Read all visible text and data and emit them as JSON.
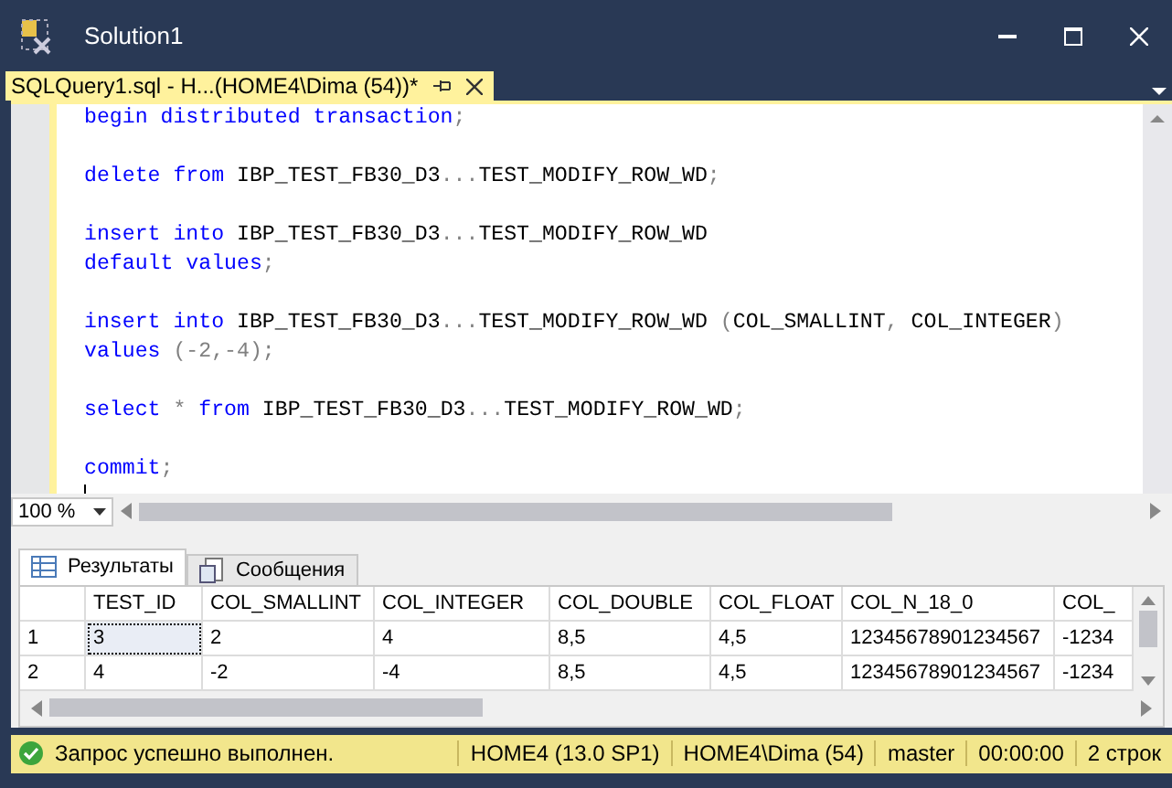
{
  "window": {
    "title": "Solution1"
  },
  "document_tab": {
    "label": "SQLQuery1.sql - H...(HOME4\\Dima (54))*",
    "selected": true
  },
  "editor": {
    "statements": [
      [
        [
          {
            "kind": "keyword",
            "text": "begin distributed transaction"
          },
          {
            "kind": "punct",
            "text": ";"
          }
        ]
      ],
      [
        [
          {
            "kind": "keyword",
            "text": "delete from"
          },
          {
            "kind": "ident",
            "text": " IBP_TEST_FB30_D3"
          },
          {
            "kind": "punct",
            "text": "..."
          },
          {
            "kind": "ident",
            "text": "TEST_MODIFY_ROW_WD"
          },
          {
            "kind": "punct",
            "text": ";"
          }
        ]
      ],
      [
        [
          {
            "kind": "keyword",
            "text": "insert into"
          },
          {
            "kind": "ident",
            "text": " IBP_TEST_FB30_D3"
          },
          {
            "kind": "punct",
            "text": "..."
          },
          {
            "kind": "ident",
            "text": "TEST_MODIFY_ROW_WD"
          }
        ],
        [
          {
            "kind": "keyword",
            "text": "default values"
          },
          {
            "kind": "punct",
            "text": ";"
          }
        ]
      ],
      [
        [
          {
            "kind": "keyword",
            "text": "insert into"
          },
          {
            "kind": "ident",
            "text": " IBP_TEST_FB30_D3"
          },
          {
            "kind": "punct",
            "text": "..."
          },
          {
            "kind": "ident",
            "text": "TEST_MODIFY_ROW_WD "
          },
          {
            "kind": "punct",
            "text": "("
          },
          {
            "kind": "ident",
            "text": "COL_SMALLINT"
          },
          {
            "kind": "punct",
            "text": ", "
          },
          {
            "kind": "ident",
            "text": "COL_INTEGER"
          },
          {
            "kind": "punct",
            "text": ")"
          }
        ],
        [
          {
            "kind": "keyword",
            "text": "values "
          },
          {
            "kind": "punct",
            "text": "(-2,-4);"
          }
        ]
      ],
      [
        [
          {
            "kind": "keyword",
            "text": "select "
          },
          {
            "kind": "punct",
            "text": "* "
          },
          {
            "kind": "keyword",
            "text": "from"
          },
          {
            "kind": "ident",
            "text": " IBP_TEST_FB30_D3"
          },
          {
            "kind": "punct",
            "text": "..."
          },
          {
            "kind": "ident",
            "text": "TEST_MODIFY_ROW_WD"
          },
          {
            "kind": "punct",
            "text": ";"
          }
        ]
      ],
      [
        [
          {
            "kind": "keyword",
            "text": "commit"
          },
          {
            "kind": "punct",
            "text": ";"
          }
        ]
      ]
    ]
  },
  "zoom": {
    "value": "100 %"
  },
  "result_tabs": [
    {
      "label": "Результаты",
      "selected": true,
      "kind": "grid"
    },
    {
      "label": "Сообщения",
      "selected": false,
      "kind": "messages"
    }
  ],
  "grid": {
    "columns": [
      "TEST_ID",
      "COL_SMALLINT",
      "COL_INTEGER",
      "COL_DOUBLE",
      "COL_FLOAT",
      "COL_N_18_0",
      "COL_"
    ],
    "rows": [
      {
        "number": "1",
        "cells": [
          {
            "text": "3",
            "focused": true
          },
          {
            "text": "2",
            "focused": false
          },
          {
            "text": "4",
            "focused": false
          },
          {
            "text": "8,5",
            "focused": false
          },
          {
            "text": "4,5",
            "focused": false
          },
          {
            "text": "12345678901234567",
            "focused": false
          },
          {
            "text": "-1234",
            "focused": false
          }
        ]
      },
      {
        "number": "2",
        "cells": [
          {
            "text": "4",
            "focused": false
          },
          {
            "text": "-2",
            "focused": false
          },
          {
            "text": "-4",
            "focused": false
          },
          {
            "text": "8,5",
            "focused": false
          },
          {
            "text": "4,5",
            "focused": false
          },
          {
            "text": "12345678901234567",
            "focused": false
          },
          {
            "text": "-1234",
            "focused": false
          }
        ]
      }
    ]
  },
  "status_bar": {
    "message": "Запрос успешно выполнен.",
    "segments": [
      "HOME4 (13.0 SP1)",
      "HOME4\\Dima (54)",
      "master",
      "00:00:00",
      "2 строк"
    ]
  }
}
